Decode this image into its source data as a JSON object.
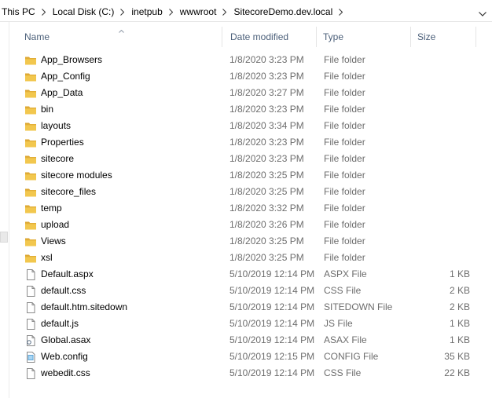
{
  "breadcrumb": [
    "This PC",
    "Local Disk (C:)",
    "inetpub",
    "wwwroot",
    "SitecoreDemo.dev.local"
  ],
  "columns": {
    "name": "Name",
    "date": "Date modified",
    "type": "Type",
    "size": "Size"
  },
  "sort": {
    "column": "name",
    "direction": "ascending"
  },
  "colors": {
    "folder": "#e8b53a",
    "header_text": "#4c607a",
    "detail_text": "#6d6d6d"
  },
  "rows": [
    {
      "icon": "folder-icon",
      "name": "App_Browsers",
      "date": "1/8/2020 3:23 PM",
      "type": "File folder",
      "size": ""
    },
    {
      "icon": "folder-icon",
      "name": "App_Config",
      "date": "1/8/2020 3:23 PM",
      "type": "File folder",
      "size": ""
    },
    {
      "icon": "folder-icon",
      "name": "App_Data",
      "date": "1/8/2020 3:27 PM",
      "type": "File folder",
      "size": ""
    },
    {
      "icon": "folder-icon",
      "name": "bin",
      "date": "1/8/2020 3:23 PM",
      "type": "File folder",
      "size": ""
    },
    {
      "icon": "folder-icon",
      "name": "layouts",
      "date": "1/8/2020 3:34 PM",
      "type": "File folder",
      "size": ""
    },
    {
      "icon": "folder-icon",
      "name": "Properties",
      "date": "1/8/2020 3:23 PM",
      "type": "File folder",
      "size": ""
    },
    {
      "icon": "folder-icon",
      "name": "sitecore",
      "date": "1/8/2020 3:23 PM",
      "type": "File folder",
      "size": ""
    },
    {
      "icon": "folder-icon",
      "name": "sitecore modules",
      "date": "1/8/2020 3:25 PM",
      "type": "File folder",
      "size": ""
    },
    {
      "icon": "folder-icon",
      "name": "sitecore_files",
      "date": "1/8/2020 3:25 PM",
      "type": "File folder",
      "size": ""
    },
    {
      "icon": "folder-icon",
      "name": "temp",
      "date": "1/8/2020 3:32 PM",
      "type": "File folder",
      "size": ""
    },
    {
      "icon": "folder-icon",
      "name": "upload",
      "date": "1/8/2020 3:26 PM",
      "type": "File folder",
      "size": ""
    },
    {
      "icon": "folder-icon",
      "name": "Views",
      "date": "1/8/2020 3:25 PM",
      "type": "File folder",
      "size": ""
    },
    {
      "icon": "folder-icon",
      "name": "xsl",
      "date": "1/8/2020 3:25 PM",
      "type": "File folder",
      "size": ""
    },
    {
      "icon": "file-icon",
      "name": "Default.aspx",
      "date": "5/10/2019 12:14 PM",
      "type": "ASPX File",
      "size": "1 KB"
    },
    {
      "icon": "file-icon",
      "name": "default.css",
      "date": "5/10/2019 12:14 PM",
      "type": "CSS File",
      "size": "2 KB"
    },
    {
      "icon": "file-icon",
      "name": "default.htm.sitedown",
      "date": "5/10/2019 12:14 PM",
      "type": "SITEDOWN File",
      "size": "2 KB"
    },
    {
      "icon": "file-icon",
      "name": "default.js",
      "date": "5/10/2019 12:14 PM",
      "type": "JS File",
      "size": "1 KB"
    },
    {
      "icon": "asax-file-icon",
      "name": "Global.asax",
      "date": "5/10/2019 12:14 PM",
      "type": "ASAX File",
      "size": "1 KB"
    },
    {
      "icon": "config-file-icon",
      "name": "Web.config",
      "date": "5/10/2019 12:15 PM",
      "type": "CONFIG File",
      "size": "35 KB"
    },
    {
      "icon": "file-icon",
      "name": "webedit.css",
      "date": "5/10/2019 12:14 PM",
      "type": "CSS File",
      "size": "22 KB"
    }
  ]
}
